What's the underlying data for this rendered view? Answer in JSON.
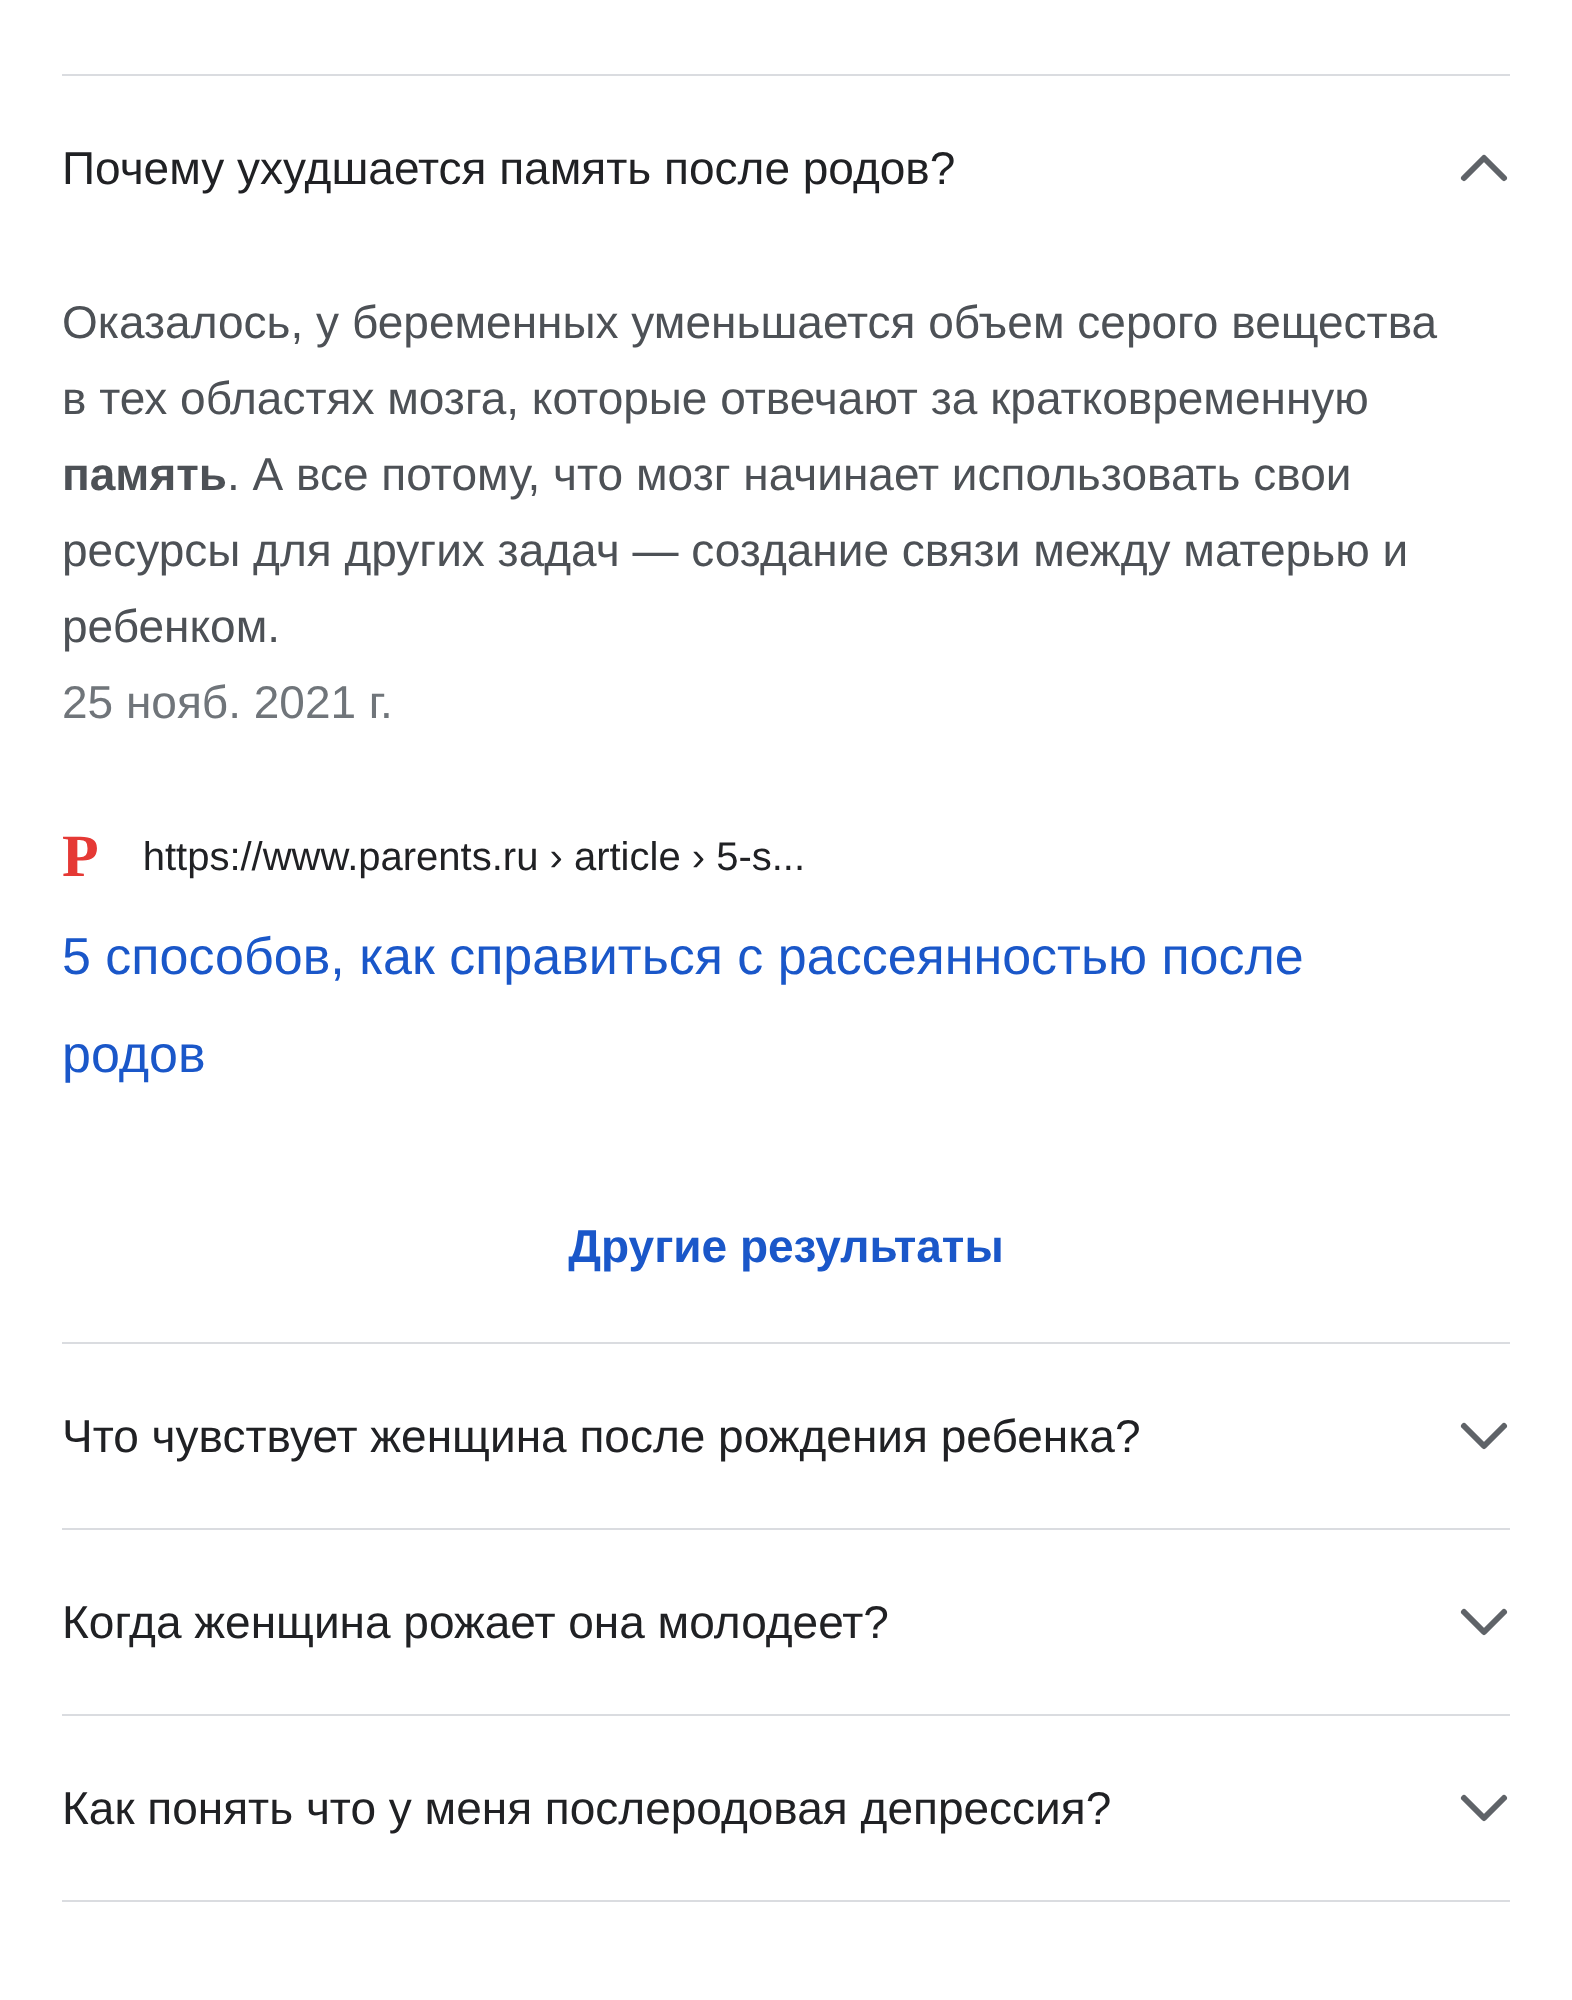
{
  "questions": [
    {
      "question": "Почему ухудшается память после родов?",
      "expanded": true,
      "answer": "Оказалось, у беременных уменьшается объем серого вещества в тех областях мозга, которые отвечают за кратковременную **память**. А все потому, что мозг начинает использовать свои ресурсы для других задач — создание связи между матерью и ребенком.",
      "date": "25 нояб. 2021 г.",
      "source_logo": "P",
      "source_url": "https://www.parents.ru › article › 5-s...",
      "source_title": "5 способов, как справиться с рассеянностью после родов"
    }
  ],
  "more_results": "Другие результаты",
  "more_questions": [
    {
      "question": "Что чувствует женщина после рождения ребенка?",
      "expanded": false
    },
    {
      "question": "Когда женщина рожает она молодеет?",
      "expanded": false
    },
    {
      "question": "Как понять что у меня послеродовая депрессия?",
      "expanded": false
    }
  ]
}
